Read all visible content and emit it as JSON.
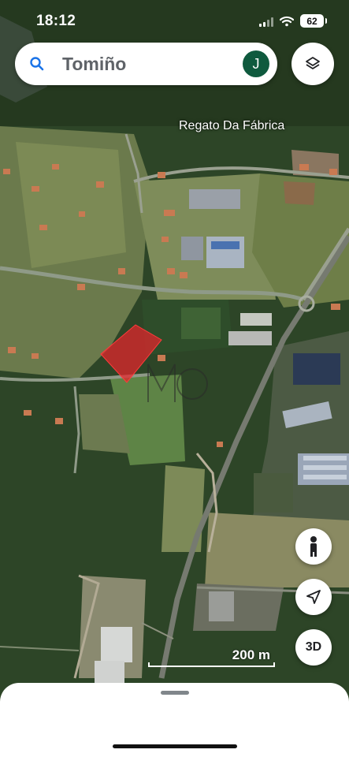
{
  "status_bar": {
    "time": "18:12",
    "battery": "62"
  },
  "search": {
    "query": "Tomiño",
    "avatar_initial": "J"
  },
  "map": {
    "place_label": "Regato Da Fábrica",
    "scale_label": "200 m",
    "watermark": "MO"
  },
  "controls": {
    "three_d_label": "3D"
  },
  "colors": {
    "avatar_bg": "#0f5a3e",
    "marker": "#e8242d",
    "search_icon": "#1a73e8"
  }
}
